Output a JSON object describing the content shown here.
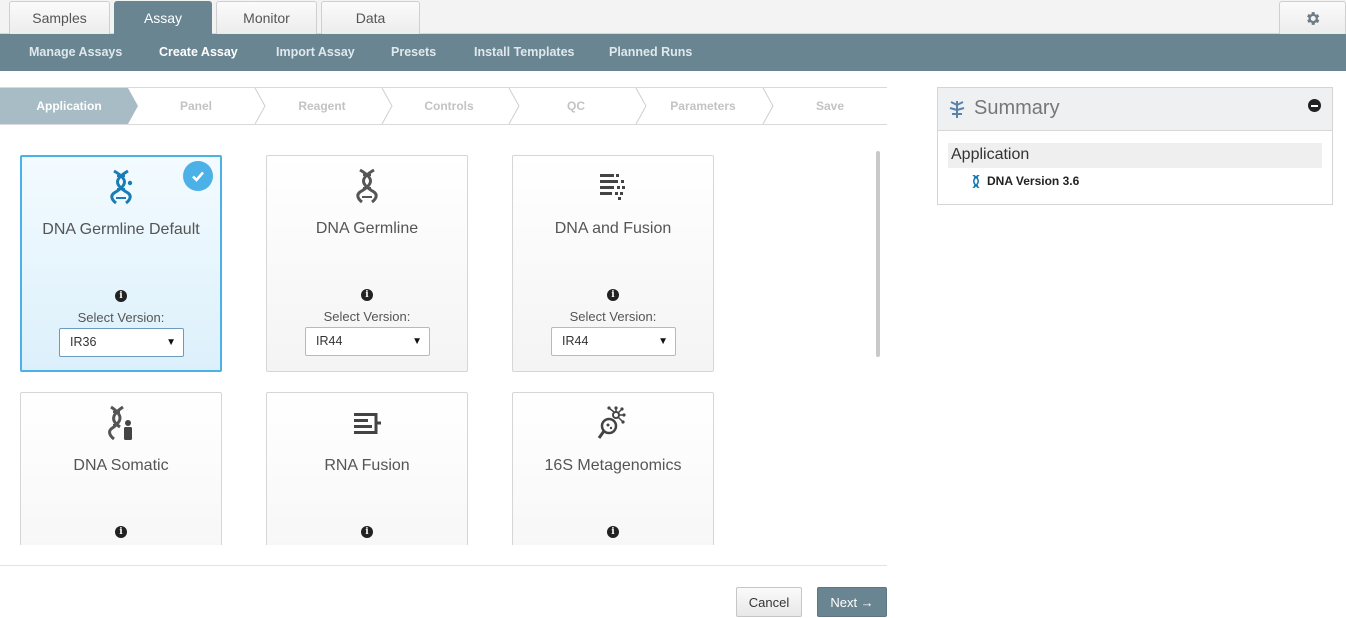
{
  "top_tabs": [
    {
      "label": "Samples",
      "active": false
    },
    {
      "label": "Assay",
      "active": true
    },
    {
      "label": "Monitor",
      "active": false
    },
    {
      "label": "Data",
      "active": false
    }
  ],
  "settings_icon": "gear-icon",
  "subnav": {
    "items": [
      "Manage Assays",
      "Create Assay",
      "Import Assay",
      "Presets",
      "Install Templates",
      "Planned Runs"
    ],
    "current": "Create Assay"
  },
  "wizard": {
    "steps": [
      "Application",
      "Panel",
      "Reagent",
      "Controls",
      "QC",
      "Parameters",
      "Save"
    ],
    "active_index": 0
  },
  "cards": [
    {
      "title": "DNA Germline Default",
      "icon": "dna-germline-icon",
      "selected": true,
      "info": "i",
      "version_label": "Select Version:",
      "version": "IR36"
    },
    {
      "title": "DNA Germline",
      "icon": "dna-icon",
      "selected": false,
      "info": "i",
      "version_label": "Select Version:",
      "version": "IR44"
    },
    {
      "title": "DNA and Fusion",
      "icon": "dna-fusion-icon",
      "selected": false,
      "info": "i",
      "version_label": "Select Version:",
      "version": "IR44"
    },
    {
      "title": "DNA Somatic",
      "icon": "dna-somatic-icon",
      "selected": false,
      "info": "i"
    },
    {
      "title": "RNA Fusion",
      "icon": "rna-fusion-icon",
      "selected": false,
      "info": "i"
    },
    {
      "title": "16S Metagenomics",
      "icon": "metagenomics-icon",
      "selected": false,
      "info": "i"
    }
  ],
  "buttons": {
    "cancel": "Cancel",
    "next": "Next →"
  },
  "summary": {
    "title": "Summary",
    "section": "Application",
    "item": "DNA Version 3.6"
  },
  "colors": {
    "accent": "#6a8592",
    "selected_border": "#4bb1e6",
    "step_active": "#a8bcc6"
  }
}
